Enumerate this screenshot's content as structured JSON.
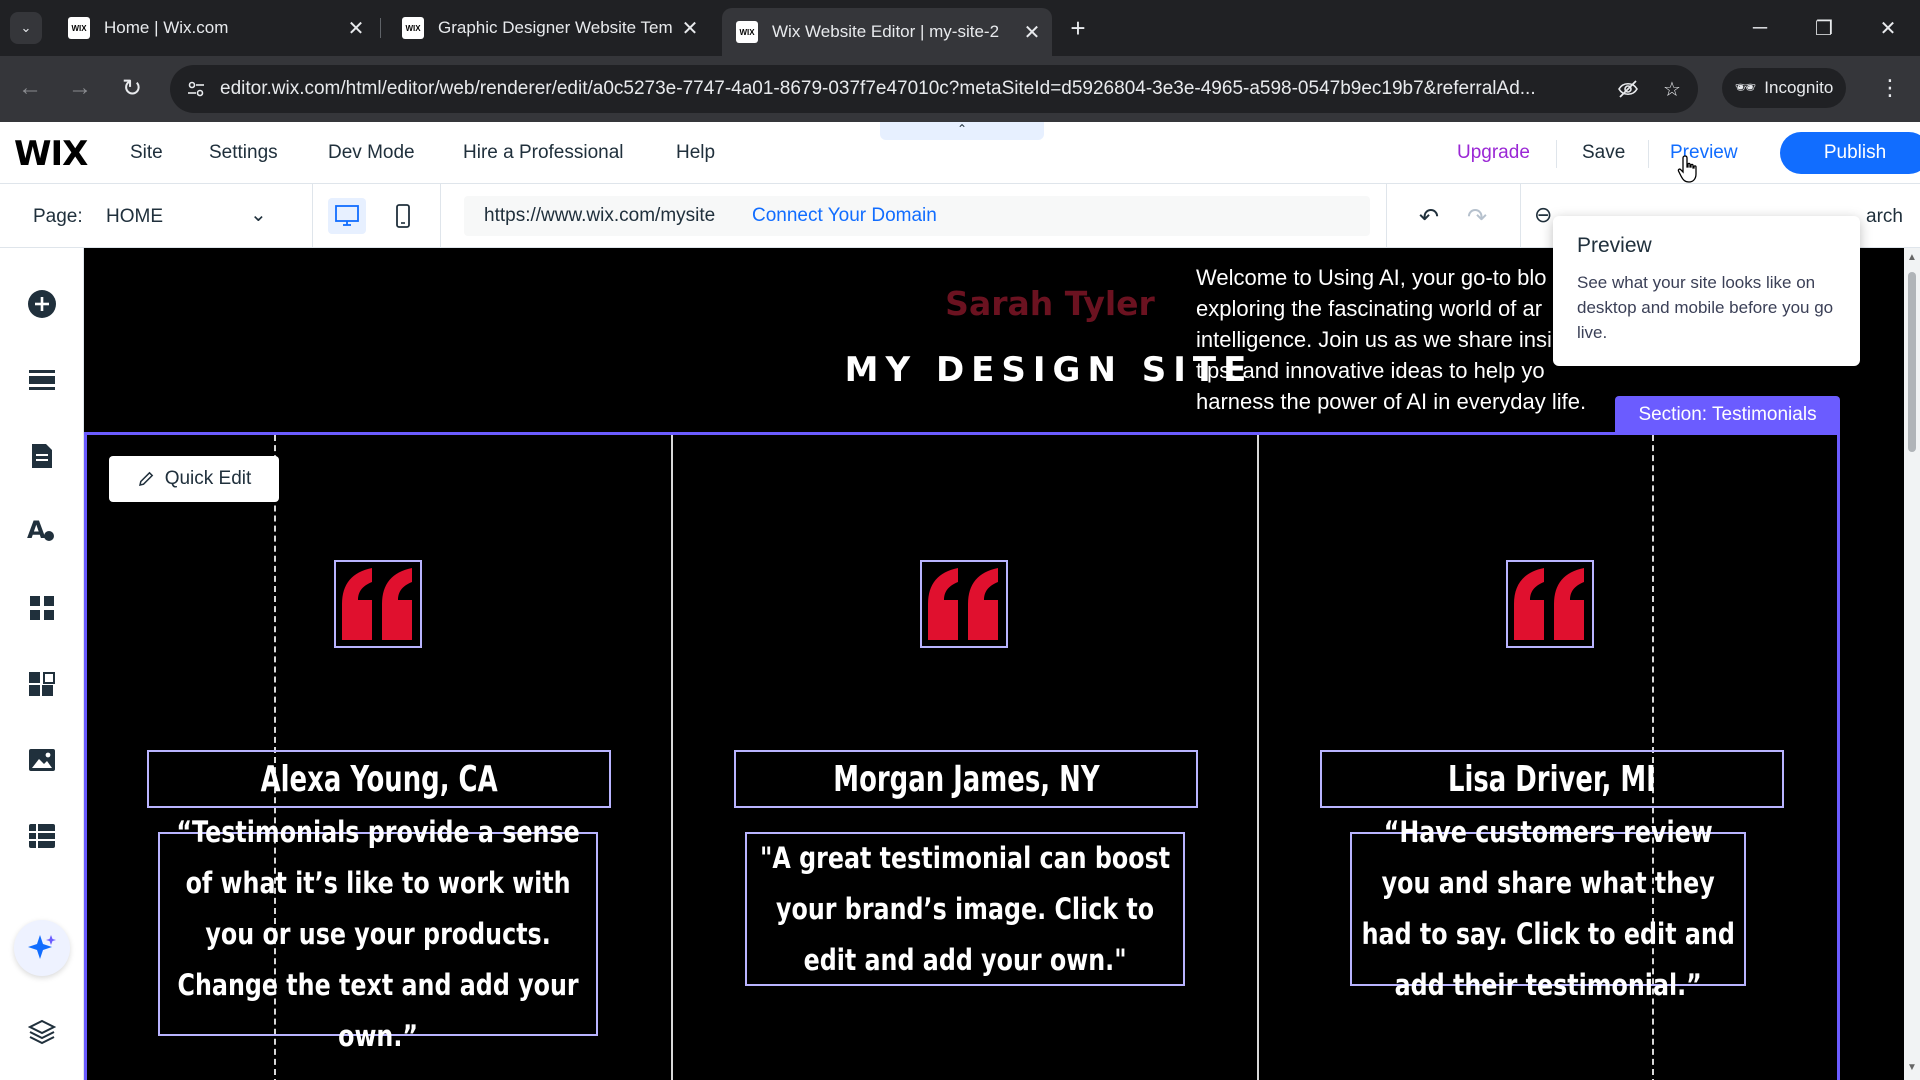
{
  "browser": {
    "tabs": [
      {
        "title": "Home | Wix.com",
        "favicon": "WIX",
        "active": false
      },
      {
        "title": "Graphic Designer Website Tem",
        "favicon": "WIX",
        "active": false
      },
      {
        "title": "Wix Website Editor | my-site-2",
        "favicon": "WIX",
        "active": true
      }
    ],
    "url": "editor.wix.com/html/editor/web/renderer/edit/a0c5273e-7747-4a01-8679-037f7e47010c?metaSiteId=d5926804-3e3e-4965-a598-0547b9ec19b7&referralAd...",
    "incognito_label": "Incognito"
  },
  "wix": {
    "logo": "WIX",
    "menu": [
      "Site",
      "Settings",
      "Dev Mode",
      "Hire a Professional",
      "Help"
    ],
    "upgrade": "Upgrade",
    "save": "Save",
    "preview": "Preview",
    "publish": "Publish",
    "page_label": "Page:",
    "page_name": "HOME",
    "site_url": "https://www.wix.com/mysite",
    "connect_domain": "Connect Your Domain",
    "search_fragment": "arch"
  },
  "tooltip": {
    "title": "Preview",
    "body": "See what your site looks like on desktop and mobile before you go live."
  },
  "canvas": {
    "header_name": "Sarah Tyler",
    "header_title": "MY DESIGN SITE",
    "header_blurb": "Welcome to Using AI, your go-to blo\nexploring the fascinating world of ar\nintelligence. Join us as we share insi\ntips, and innovative ideas to help yo\nharness the power of AI in everyday life.",
    "section_badge": "Section: Testimonials",
    "quick_edit": "Quick Edit",
    "testimonials": [
      {
        "name": "Alexa Young, CA",
        "quote": "“Testimonials provide a sense of what it’s like to work with you or use your products. Change the text and add your own.”"
      },
      {
        "name": "Morgan James, NY",
        "quote": "\"A great testimonial can boost your brand’s image. Click to edit and add your own.\""
      },
      {
        "name": "Lisa Driver, MI",
        "quote": "“Have customers review you and share what they had to say. Click to edit and add their testimonial.”"
      }
    ]
  },
  "colors": {
    "accent": "#116dff",
    "upgrade": "#9a27d5",
    "section_selection": "#6b5cff",
    "quote_red": "#e0102e"
  }
}
